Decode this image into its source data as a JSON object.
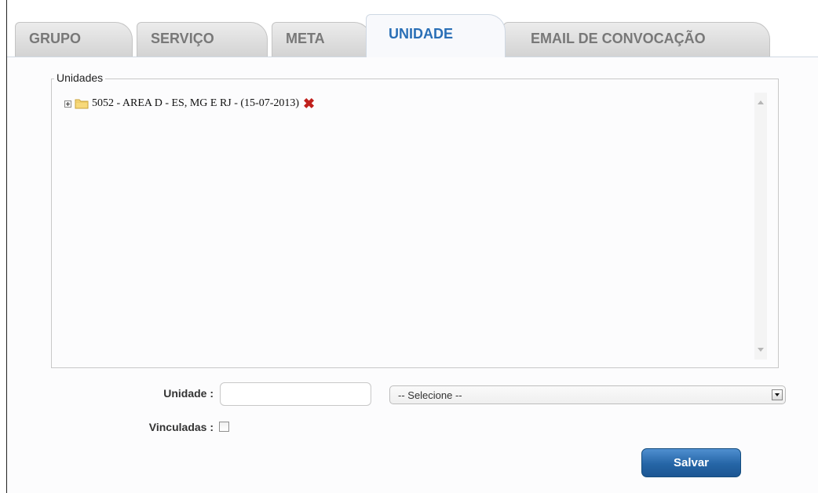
{
  "tabs": [
    {
      "label": "GRUPO",
      "active": false
    },
    {
      "label": "SERVIÇO",
      "active": false
    },
    {
      "label": "META",
      "active": false
    },
    {
      "label": "UNIDADE",
      "active": true
    },
    {
      "label": "EMAIL DE CONVOCAÇÃO",
      "active": false
    }
  ],
  "unidades": {
    "legend": "Unidades",
    "tree": [
      {
        "label": "5052 - AREA D - ES, MG E RJ - (15-07-2013)",
        "icon": "folder-icon",
        "delete_icon": "delete-x-icon"
      }
    ]
  },
  "form": {
    "unidade_label": "Unidade :",
    "unidade_value": "",
    "select_value": "-- Selecione --",
    "vinculadas_label": "Vinculadas :",
    "vinculadas_checked": false,
    "save_label": "Salvar"
  },
  "colors": {
    "active_tab_text": "#2a6fb6",
    "inactive_tab_text": "#787878",
    "save_button": "#2565a6",
    "delete_icon": "#c0201c"
  }
}
